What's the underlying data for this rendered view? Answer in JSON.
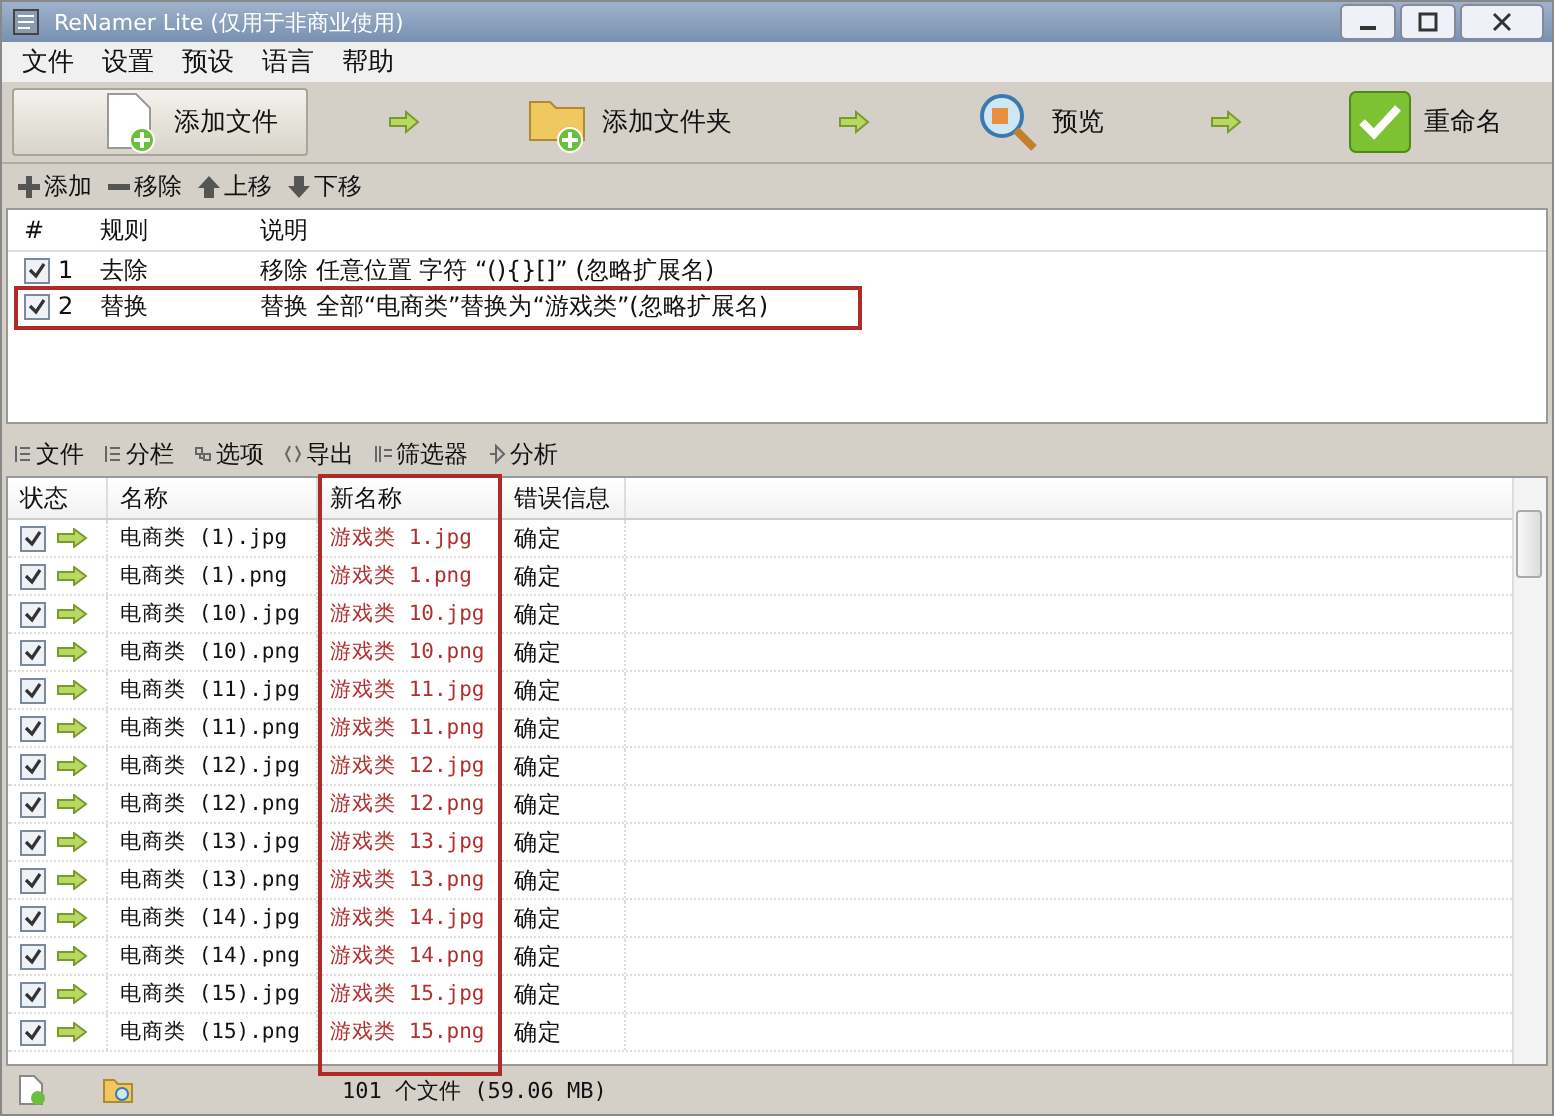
{
  "window": {
    "title": "ReNamer Lite (仅用于非商业使用)"
  },
  "menu": [
    "文件",
    "设置",
    "预设",
    "语言",
    "帮助"
  ],
  "toolbar": [
    {
      "kind": "file",
      "label": "添加文件",
      "selected": true
    },
    {
      "kind": "folder",
      "label": "添加文件夹",
      "selected": false
    },
    {
      "kind": "preview",
      "label": "预览",
      "selected": false
    },
    {
      "kind": "rename",
      "label": "重命名",
      "selected": false
    }
  ],
  "rule_actions": [
    {
      "kind": "add",
      "label": "添加"
    },
    {
      "kind": "remove",
      "label": "移除"
    },
    {
      "kind": "up",
      "label": "上移"
    },
    {
      "kind": "down",
      "label": "下移"
    }
  ],
  "rules": {
    "columns": [
      "#",
      "规则",
      "说明"
    ],
    "rows": [
      {
        "checked": true,
        "index": "1",
        "rule": "去除",
        "description": "移除 任意位置 字符 “(){}[]” (忽略扩展名)",
        "highlighted": false
      },
      {
        "checked": true,
        "index": "2",
        "rule": "替换",
        "description": "替换 全部“电商类”替换为“游戏类”(忽略扩展名)",
        "highlighted": true
      }
    ]
  },
  "file_tabs": [
    {
      "kind": "files",
      "label": "文件"
    },
    {
      "kind": "columns",
      "label": "分栏"
    },
    {
      "kind": "options",
      "label": "选项"
    },
    {
      "kind": "export",
      "label": "导出"
    },
    {
      "kind": "filter",
      "label": "筛选器"
    },
    {
      "kind": "analyze",
      "label": "分析"
    }
  ],
  "files": {
    "columns": [
      {
        "label": "状态",
        "highlighted": false
      },
      {
        "label": "名称",
        "highlighted": false
      },
      {
        "label": "新名称",
        "highlighted": true
      },
      {
        "label": "错误信息",
        "highlighted": false
      }
    ],
    "rows": [
      {
        "checked": true,
        "name": "电商类 (1).jpg",
        "new_name": "游戏类 1.jpg",
        "error": "确定"
      },
      {
        "checked": true,
        "name": "电商类 (1).png",
        "new_name": "游戏类 1.png",
        "error": "确定"
      },
      {
        "checked": true,
        "name": "电商类 (10).jpg",
        "new_name": "游戏类 10.jpg",
        "error": "确定"
      },
      {
        "checked": true,
        "name": "电商类 (10).png",
        "new_name": "游戏类 10.png",
        "error": "确定"
      },
      {
        "checked": true,
        "name": "电商类 (11).jpg",
        "new_name": "游戏类 11.jpg",
        "error": "确定"
      },
      {
        "checked": true,
        "name": "电商类 (11).png",
        "new_name": "游戏类 11.png",
        "error": "确定"
      },
      {
        "checked": true,
        "name": "电商类 (12).jpg",
        "new_name": "游戏类 12.jpg",
        "error": "确定"
      },
      {
        "checked": true,
        "name": "电商类 (12).png",
        "new_name": "游戏类 12.png",
        "error": "确定"
      },
      {
        "checked": true,
        "name": "电商类 (13).jpg",
        "new_name": "游戏类 13.jpg",
        "error": "确定"
      },
      {
        "checked": true,
        "name": "电商类 (13).png",
        "new_name": "游戏类 13.png",
        "error": "确定"
      },
      {
        "checked": true,
        "name": "电商类 (14).jpg",
        "new_name": "游戏类 14.jpg",
        "error": "确定"
      },
      {
        "checked": true,
        "name": "电商类 (14).png",
        "new_name": "游戏类 14.png",
        "error": "确定"
      },
      {
        "checked": true,
        "name": "电商类 (15).jpg",
        "new_name": "游戏类 15.jpg",
        "error": "确定"
      },
      {
        "checked": true,
        "name": "电商类 (15).png",
        "new_name": "游戏类 15.png",
        "error": "确定"
      }
    ]
  },
  "status_bar": {
    "summary": "101 个文件 (59.06 MB)"
  }
}
